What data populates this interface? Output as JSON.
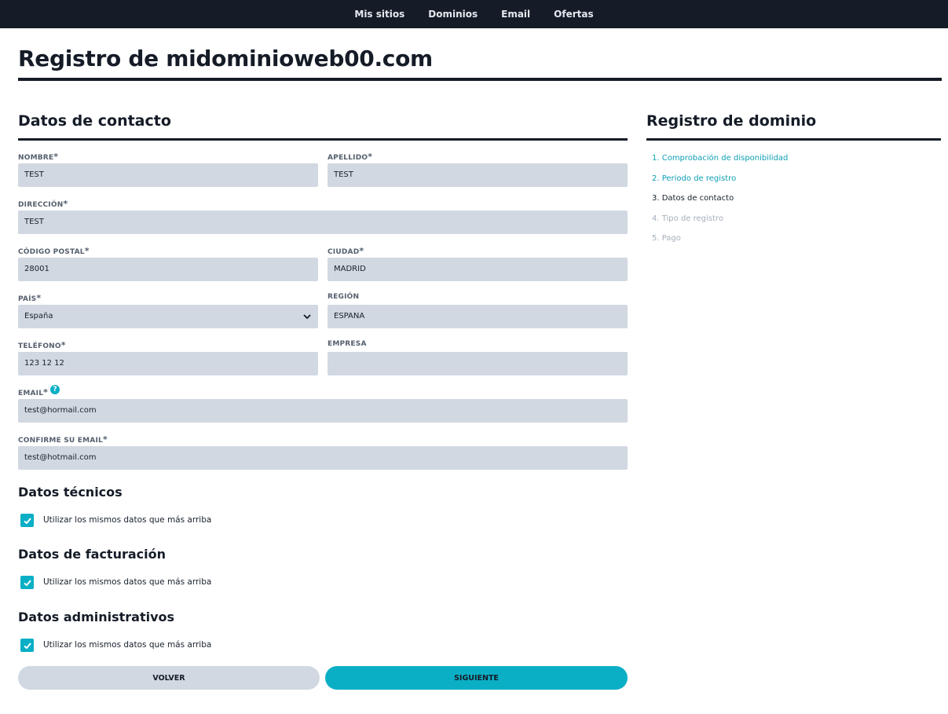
{
  "nav": {
    "items": [
      "Mis sitios",
      "Dominios",
      "Email",
      "Ofertas"
    ]
  },
  "page": {
    "title": "Registro de midominioweb00.com"
  },
  "contact": {
    "section_title": "Datos de contacto",
    "required_mark": "*",
    "fields": {
      "nombre": {
        "label": "NOMBRE",
        "value": "TEST"
      },
      "apellido": {
        "label": "APELLIDO",
        "value": "TEST"
      },
      "direccion": {
        "label": "DIRECCIÓN",
        "value": "TEST"
      },
      "codigo_postal": {
        "label": "CÓDIGO POSTAL",
        "value": "28001"
      },
      "ciudad": {
        "label": "CIUDAD",
        "value": "MADRID"
      },
      "pais": {
        "label": "PAÍS",
        "value": "España"
      },
      "region": {
        "label": "REGIÓN",
        "value": "ESPANA"
      },
      "telefono": {
        "label": "TELÉFONO",
        "value": "123 12 12"
      },
      "empresa": {
        "label": "EMPRESA",
        "value": ""
      },
      "email": {
        "label": "EMAIL",
        "value": "test@hormail.com",
        "help": "?"
      },
      "confirm_email": {
        "label": "CONFIRME SU EMAIL",
        "value": "test@hotmail.com"
      }
    }
  },
  "tecnicos": {
    "title": "Datos técnicos",
    "checkbox_label": "Utilizar los mismos datos que más arriba",
    "checked": true
  },
  "facturacion": {
    "title": "Datos de facturación",
    "checkbox_label": "Utilizar los mismos datos que más arriba",
    "checked": true
  },
  "administrativos": {
    "title": "Datos administrativos",
    "checkbox_label": "Utilizar los mismos datos que más arriba",
    "checked": true
  },
  "buttons": {
    "back": "VOLVER",
    "next": "SIGUIENTE"
  },
  "sidebar": {
    "title": "Registro de dominio",
    "steps": [
      {
        "label": "1. Comprobación de disponibilidad",
        "state": "done"
      },
      {
        "label": "2. Periodo de registro",
        "state": "done"
      },
      {
        "label": "3. Datos de contacto",
        "state": "current"
      },
      {
        "label": "4. Tipo de registro",
        "state": "pending"
      },
      {
        "label": "5. Pago",
        "state": "pending"
      }
    ]
  },
  "colors": {
    "accent": "#0aafc5",
    "dark": "#151c27",
    "field_bg": "#d1d8e1"
  }
}
